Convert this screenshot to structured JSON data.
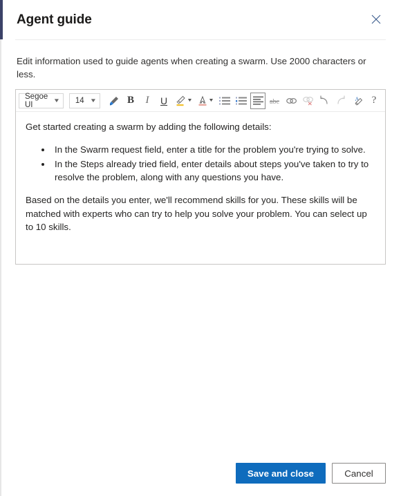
{
  "window": {
    "title": "Agent guide",
    "close_icon": "close-icon",
    "accent_color": "#3b4268"
  },
  "description": "Edit information used to guide agents when creating a swarm. Use 2000 characters or less.",
  "editor": {
    "toolbar": {
      "font_family": {
        "value": "Segoe UI",
        "icon": "chevron-down-icon"
      },
      "font_size": {
        "value": "14",
        "icon": "chevron-down-icon"
      },
      "buttons": [
        {
          "name": "format-painter-icon",
          "label": "Format painter"
        },
        {
          "name": "bold-icon",
          "label": "B"
        },
        {
          "name": "italic-icon",
          "label": "I"
        },
        {
          "name": "underline-icon",
          "label": "U"
        },
        {
          "name": "highlight-color-icon",
          "label": "Highlight"
        },
        {
          "name": "font-color-icon",
          "label": "Font color"
        },
        {
          "name": "bulleted-list-icon",
          "label": "Bulleted list"
        },
        {
          "name": "numbered-list-icon",
          "label": "Numbered list"
        },
        {
          "name": "align-left-icon",
          "label": "Align left"
        },
        {
          "name": "strikethrough-icon",
          "label": "Strikethrough"
        },
        {
          "name": "link-icon",
          "label": "Insert link"
        },
        {
          "name": "unlink-icon",
          "label": "Remove link"
        },
        {
          "name": "undo-icon",
          "label": "Undo"
        },
        {
          "name": "redo-icon",
          "label": "Redo"
        },
        {
          "name": "clear-formatting-icon",
          "label": "Clear formatting"
        },
        {
          "name": "help-icon",
          "label": "?"
        }
      ]
    },
    "content": {
      "intro": "Get started creating a swarm by adding the following details:",
      "bullets": [
        "In the Swarm request field, enter a title for the problem you're trying to solve.",
        "In the Steps already tried field, enter details about steps you've taken to try to resolve the problem, along with any questions you have."
      ],
      "closing": "Based on the details you enter, we'll recommend skills for you. These skills will be matched with experts who can try to help you solve your problem. You can select up to 10 skills."
    }
  },
  "footer": {
    "save_label": "Save and close",
    "cancel_label": "Cancel",
    "primary_color": "#0f6cbd"
  }
}
